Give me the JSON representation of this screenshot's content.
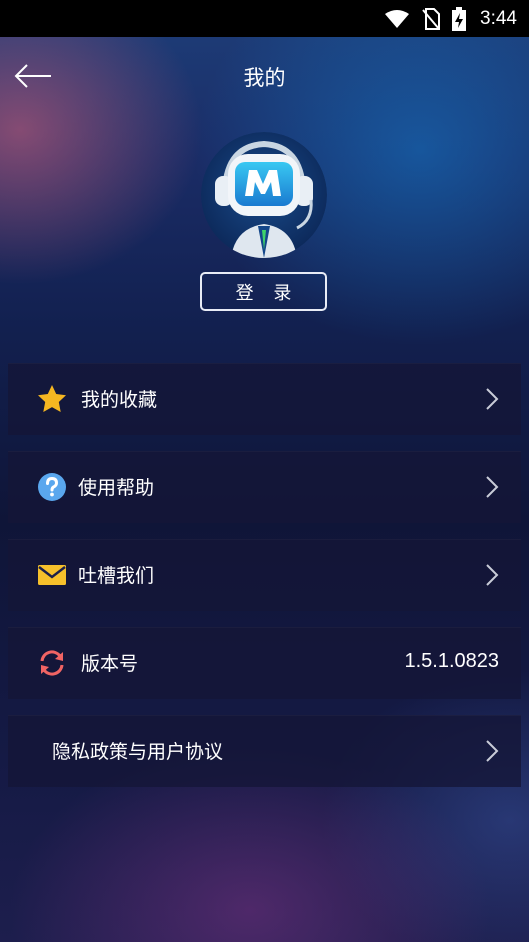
{
  "status_bar": {
    "time": "3:44"
  },
  "header": {
    "title": "我的"
  },
  "profile": {
    "login_label": "登 录"
  },
  "menu": {
    "items": [
      {
        "icon": "star-icon",
        "label": "我的收藏"
      },
      {
        "icon": "help-icon",
        "label": "使用帮助"
      },
      {
        "icon": "mail-icon",
        "label": "吐槽我们"
      },
      {
        "icon": "refresh-icon",
        "label": "版本号",
        "value": "1.5.1.0823"
      },
      {
        "label": "隐私政策与用户协议"
      }
    ]
  },
  "colors": {
    "star": "#f5b621",
    "help": "#5aa7ee",
    "mail": "#f6c02b",
    "refresh": "#f06464"
  }
}
